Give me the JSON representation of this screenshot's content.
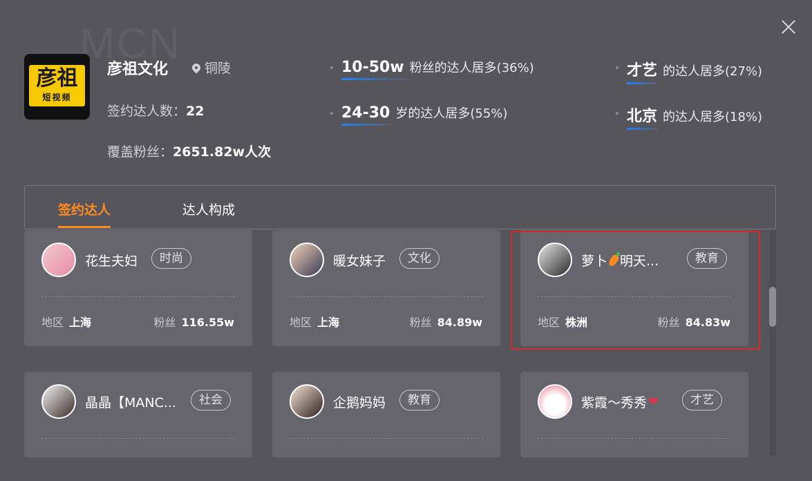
{
  "watermark": "MCN",
  "org": {
    "logo_big": "彦祖",
    "logo_small": "短视频",
    "name": "彦祖文化",
    "location": "铜陵",
    "signed_label": "签约达人数：",
    "signed_value": "22",
    "fans_label": "覆盖粉丝：",
    "fans_value": "2651.82w人次"
  },
  "highlights": [
    {
      "key": "10-50w",
      "text": "粉丝的达人居多(36%)"
    },
    {
      "key": "才艺",
      "text": "的达人居多(27%)"
    },
    {
      "key": "24-30",
      "text": "岁的达人居多(55%)"
    },
    {
      "key": "北京",
      "text": "的达人居多(18%)"
    }
  ],
  "tabs": [
    {
      "label": "签约达人",
      "active": true
    },
    {
      "label": "达人构成",
      "active": false
    }
  ],
  "meta_labels": {
    "region": "地区",
    "fans": "粉丝"
  },
  "cards": [
    {
      "name": "花生夫妇",
      "tag": "时尚",
      "region": "上海",
      "fans": "116.55w",
      "avatar": "couple-avatar"
    },
    {
      "name": "暖女妹子",
      "tag": "文化",
      "region": "上海",
      "fans": "84.89w",
      "avatar": "girl-avatar"
    },
    {
      "name_a": "萝卜",
      "name_b": "明天...",
      "tag": "教育",
      "region": "株洲",
      "fans": "84.83w",
      "avatar": "child-avatar"
    },
    {
      "name": "晶晶【MANC...",
      "tag": "社会",
      "avatar": "woman-avatar"
    },
    {
      "name": "企鹅妈妈",
      "tag": "教育",
      "avatar": "mom-avatar"
    },
    {
      "name": "紫霞～秀秀",
      "tag": "才艺",
      "avatar": "cartoon-avatar"
    }
  ]
}
